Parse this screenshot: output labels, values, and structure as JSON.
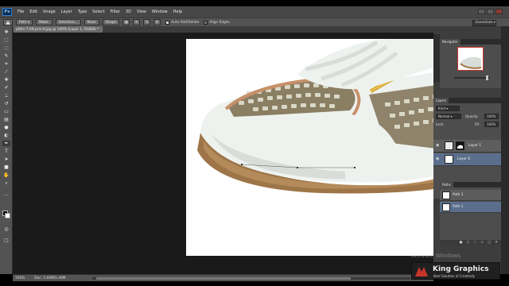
{
  "app": {
    "logo_text": "Ps",
    "menu": [
      "File",
      "Edit",
      "Image",
      "Layer",
      "Type",
      "Select",
      "Filter",
      "3D",
      "View",
      "Window",
      "Help"
    ]
  },
  "options_bar": {
    "tool_preset": "",
    "path_mode": "Path",
    "buttons": [
      "Make:",
      "Selection...",
      "Mask",
      "Shape"
    ],
    "auto_add_delete_label": "Auto Add/Delete",
    "align_edges_label": "Align Edges",
    "auto_add_delete_checked": true,
    "align_edges_checked": false,
    "workspace": "Essentials"
  },
  "document": {
    "tab_title": "pttlin-7-09-pris-H.jpg @ 100% (Layer 1, RGB/8) *",
    "tab_close": "×"
  },
  "status_bar": {
    "zoom": "100%",
    "doc_size": "Doc: 5.60M/5.49M"
  },
  "panels": {
    "navigator_tabs": [
      "Navigator"
    ],
    "layers_tabs": [
      "Layers"
    ],
    "layer_kind": "Kind",
    "blend_mode": "Normal",
    "opacity_label": "Opacity:",
    "opacity_value": "100%",
    "lock_label": "Lock:",
    "fill_label": "Fill:",
    "fill_value": "100%",
    "layers": [
      {
        "name": "Layer 1",
        "selected": false,
        "has_mask": true
      },
      {
        "name": "Layer 0",
        "selected": true,
        "has_mask": false
      }
    ],
    "paths_tabs": [
      "Paths"
    ],
    "paths": [
      {
        "name": "Path 1",
        "selected": false
      },
      {
        "name": "Path 1",
        "selected": true
      }
    ]
  },
  "watermark": {
    "activate_text": "Activate Windows",
    "brand_name": "King Graphics",
    "brand_tagline": "Best Solution of Creativity"
  },
  "colors": {
    "ui_dark": "#535353",
    "panel_bg": "#4d4d4d",
    "selection_blue": "#5b6f8c",
    "accent_red": "#c9352b"
  }
}
